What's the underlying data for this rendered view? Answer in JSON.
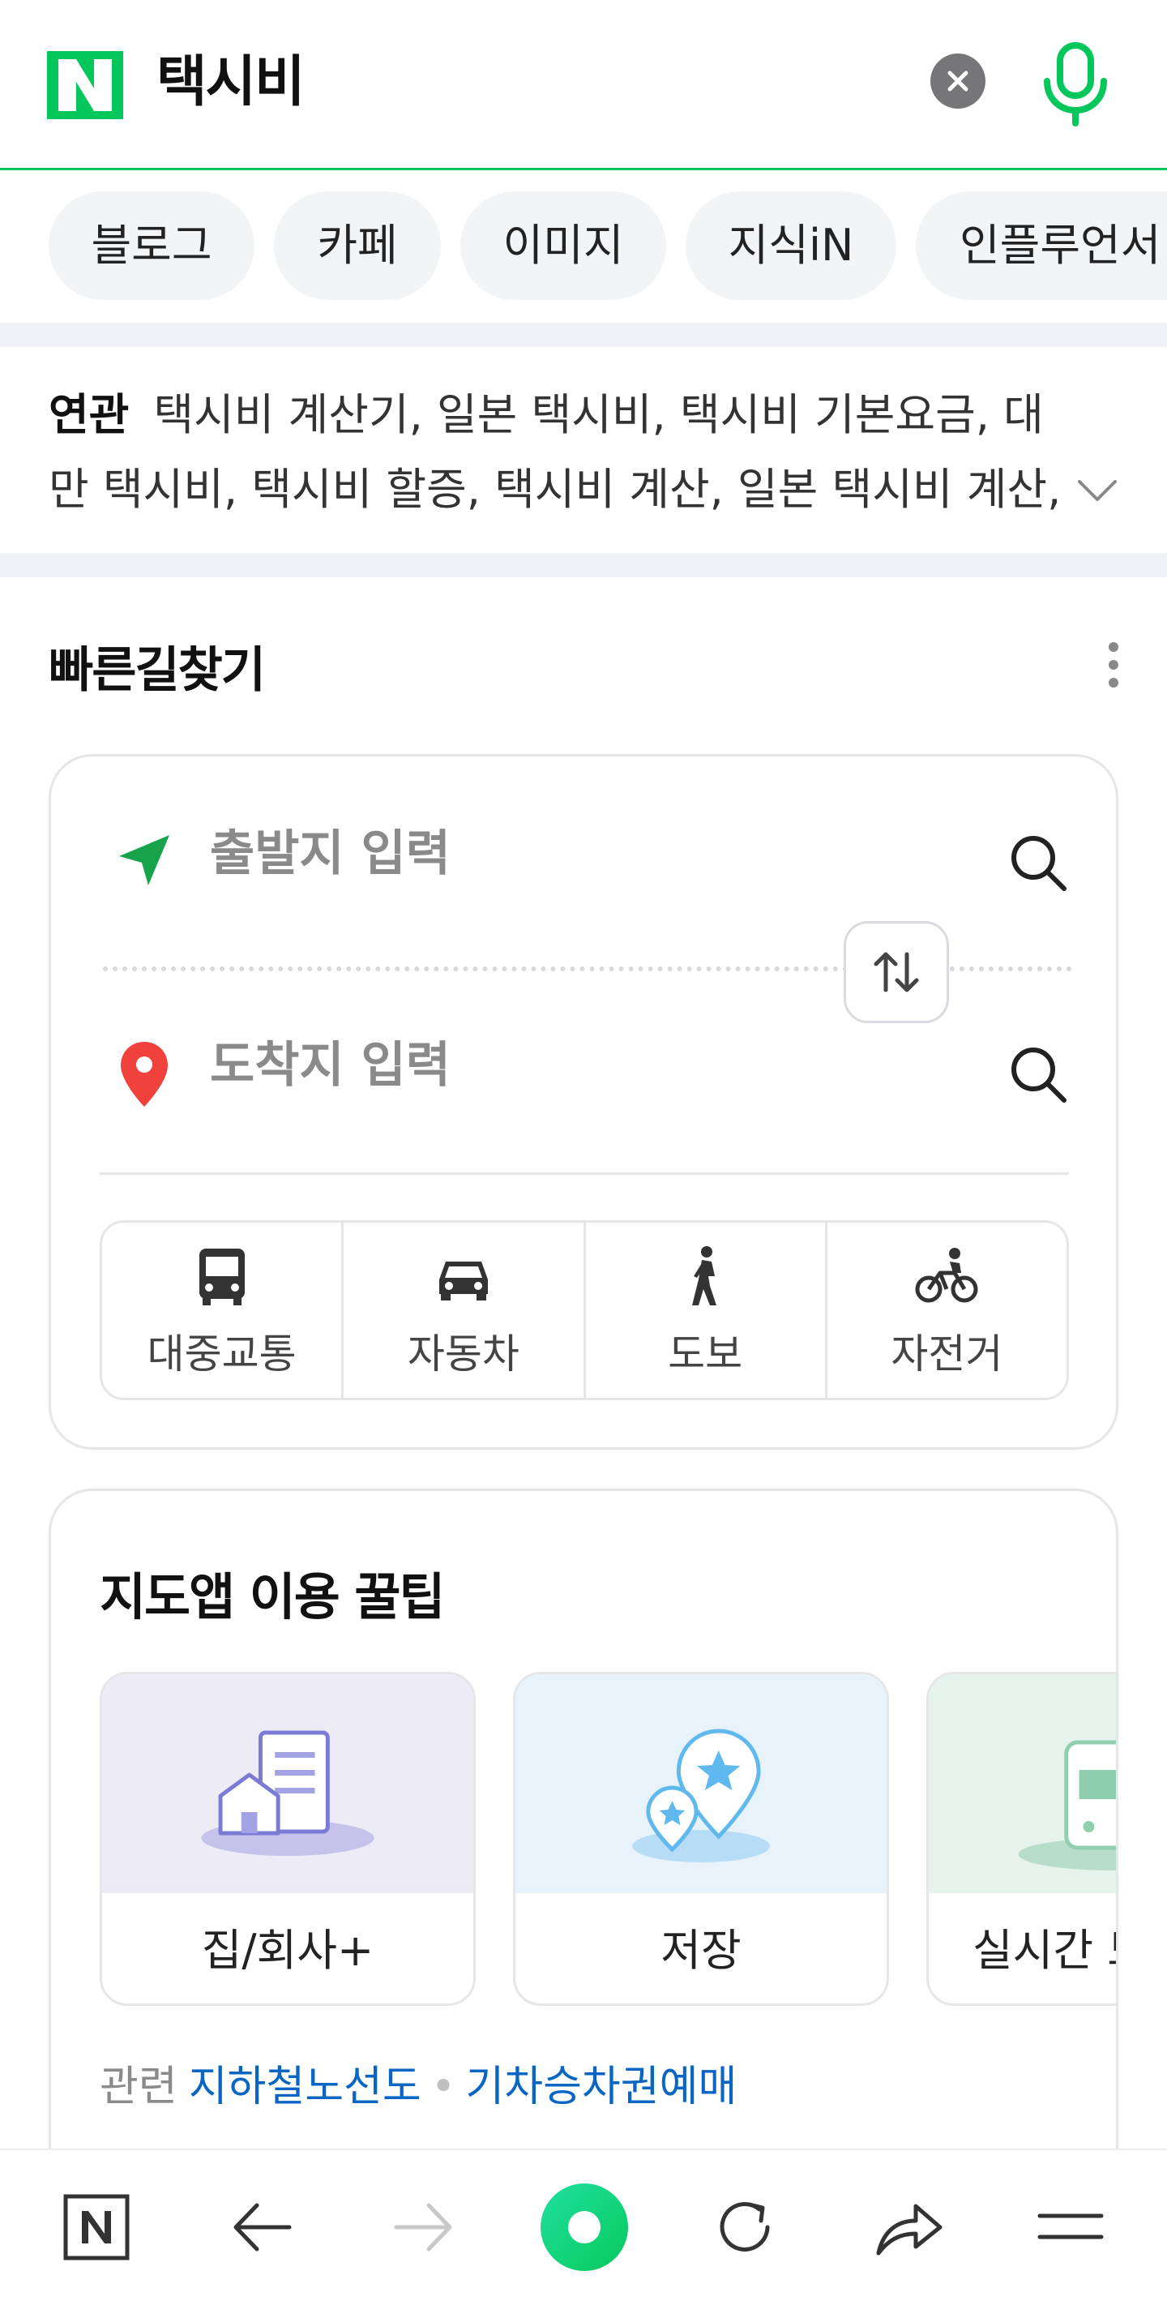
{
  "header": {
    "logo_letter": "N",
    "query": "택시비",
    "clear_icon": "clear-icon",
    "mic_icon": "microphone-icon",
    "brand_color": "#03c75a"
  },
  "tabs": [
    {
      "label": "블로그"
    },
    {
      "label": "카페"
    },
    {
      "label": "이미지"
    },
    {
      "label": "지식iN"
    },
    {
      "label": "인플루언서"
    }
  ],
  "related": {
    "label": "연관",
    "text": "택시비 계산기, 일본 택시비, 택시비 기본요금, 대만 택시비, 택시비 할증, 택시비 계산, 일본 택시비 계산, 택"
  },
  "route": {
    "title": "빠른길찾기",
    "origin_placeholder": "출발지 입력",
    "destination_placeholder": "도착지 입력",
    "modes": [
      {
        "label": "대중교통",
        "icon": "bus-icon"
      },
      {
        "label": "자동차",
        "icon": "car-icon"
      },
      {
        "label": "도보",
        "icon": "walk-icon"
      },
      {
        "label": "자전거",
        "icon": "bicycle-icon"
      }
    ]
  },
  "tips": {
    "title": "지도앱 이용 꿀팁",
    "items": [
      {
        "label": "집/회사+",
        "icon": "home-office-icon"
      },
      {
        "label": "저장",
        "icon": "saved-places-icon"
      },
      {
        "label": "실시간 도",
        "icon": "bus-realtime-icon"
      }
    ],
    "related_label": "관련",
    "links": [
      "지하철노선도",
      "기차승차권예매"
    ],
    "separator": "•"
  },
  "bottom_nav": [
    {
      "icon": "naver-home-icon"
    },
    {
      "icon": "back-arrow-icon"
    },
    {
      "icon": "forward-arrow-icon"
    },
    {
      "icon": "green-dot-icon"
    },
    {
      "icon": "refresh-icon"
    },
    {
      "icon": "share-icon"
    },
    {
      "icon": "menu-icon"
    }
  ]
}
